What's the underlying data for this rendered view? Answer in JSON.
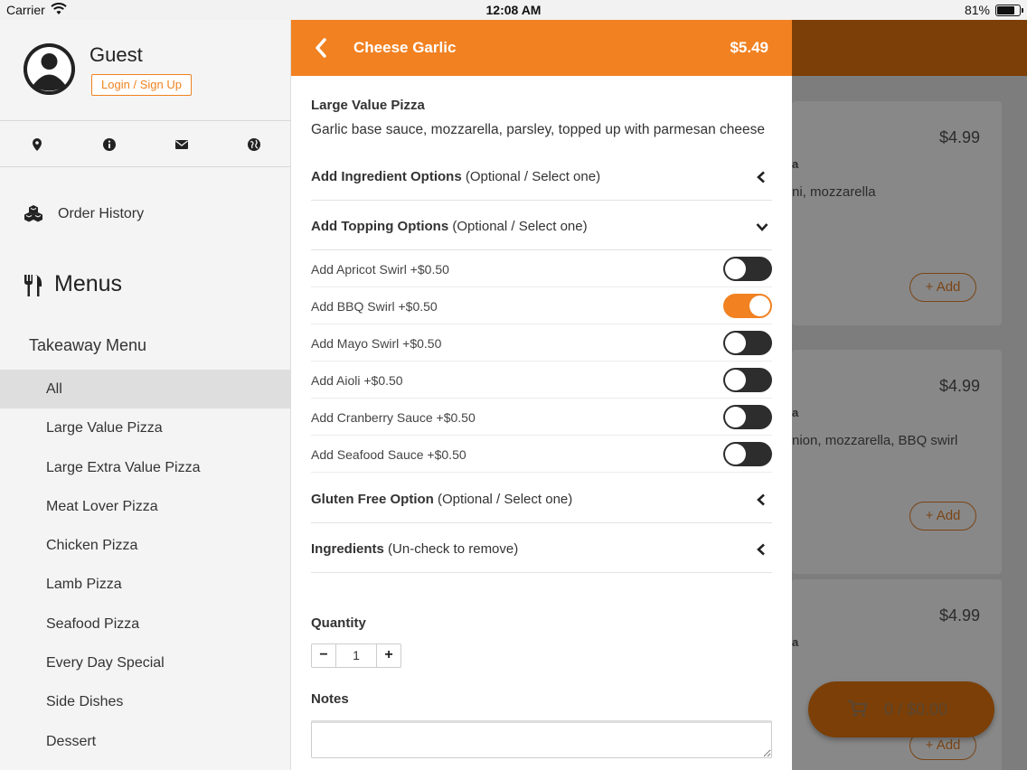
{
  "status_bar": {
    "carrier": "Carrier",
    "time": "12:08 AM",
    "battery": "81%"
  },
  "sidebar": {
    "user_name": "Guest",
    "login_label": "Login / Sign Up",
    "icons": [
      "map-pin-icon",
      "info-icon",
      "envelope-icon",
      "globe-icon"
    ],
    "order_history": "Order History",
    "menus_heading": "Menus",
    "takeaway_menu": "Takeaway Menu",
    "categories": [
      "All",
      "Large Value Pizza",
      "Large Extra Value Pizza",
      "Meat Lover Pizza",
      "Chicken Pizza",
      "Lamb Pizza",
      "Seafood Pizza",
      "Every Day Special",
      "Side Dishes",
      "Dessert"
    ],
    "active_category": "All"
  },
  "panel": {
    "title": "Cheese Garlic",
    "price": "$5.49",
    "category": "Large Value Pizza",
    "description": "Garlic base sauce, mozzarella, parsley, topped up with parmesan cheese",
    "sections": {
      "ingredient_options": {
        "title": "Add Ingredient Options",
        "hint": "(Optional / Select one)"
      },
      "topping_options": {
        "title": "Add Topping Options",
        "hint": "(Optional / Select one)"
      },
      "gluten_free": {
        "title": "Gluten Free Option",
        "hint": "(Optional / Select one)"
      },
      "ingredients": {
        "title": "Ingredients",
        "hint": "(Un-check to remove)"
      }
    },
    "toppings": [
      {
        "label": "Add Apricot Swirl +$0.50",
        "on": false
      },
      {
        "label": "Add BBQ Swirl +$0.50",
        "on": true
      },
      {
        "label": "Add Mayo Swirl +$0.50",
        "on": false
      },
      {
        "label": "Add Aioli +$0.50",
        "on": false
      },
      {
        "label": "Add Cranberry Sauce +$0.50",
        "on": false
      },
      {
        "label": "Add Seafood Sauce +$0.50",
        "on": false
      }
    ],
    "quantity_label": "Quantity",
    "quantity": "1",
    "minus": "−",
    "plus": "+",
    "notes_label": "Notes",
    "notes_value": ""
  },
  "background": {
    "cards": [
      {
        "price": "$4.99",
        "category": "a",
        "desc": "ni, mozzarella",
        "add": "+ Add"
      },
      {
        "price": "$4.99",
        "category": "a",
        "desc": "nion, mozzarella, BBQ swirl",
        "add": "+ Add"
      },
      {
        "price": "$4.99",
        "category": "a",
        "desc": "",
        "add": "+ Add"
      }
    ],
    "cart": "0 / $0.00"
  },
  "colors": {
    "accent": "#f18121",
    "header_dim": "#7b3f07"
  }
}
